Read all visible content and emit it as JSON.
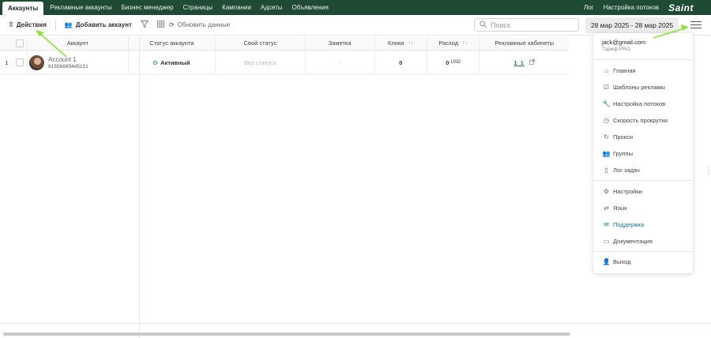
{
  "topnav": {
    "tabs": [
      {
        "label": "Аккаунты",
        "active": true
      },
      {
        "label": "Рекламные аккаунты"
      },
      {
        "label": "Бизнес менеджер"
      },
      {
        "label": "Страницы"
      },
      {
        "label": "Кампании"
      },
      {
        "label": "Адсеты"
      },
      {
        "label": "Объявления"
      }
    ],
    "right_links": [
      "Лог",
      "Настройка потоков"
    ],
    "brand": "Saint"
  },
  "toolbar": {
    "actions_label": "Действия",
    "add_account_label": "Добавить аккаунт",
    "refresh_label": "Обновить данные",
    "search_placeholder": "Поиск",
    "date_range": "28 мар 2025 - 28 мар 2025"
  },
  "table": {
    "headers": {
      "account": "Аккаунт",
      "account_status": "Статус аккаунта",
      "own_status": "Свой статус",
      "note": "Заметка",
      "clicks": "Клики",
      "spend": "Расход",
      "ad_cabinets": "Рекламные кабинеты"
    },
    "rows": [
      {
        "index": "1",
        "name": "Account 1",
        "id": "61556685445151",
        "status": "Активный",
        "own_status": "Без статуса",
        "note": "-",
        "clicks": "0",
        "spend": "0",
        "currency": "USD",
        "cabinets": "1 1"
      }
    ]
  },
  "menu": {
    "email": "jack@gmail.com",
    "plan": "Тариф PRO",
    "items": [
      {
        "label": "Главная",
        "icon": "home-icon"
      },
      {
        "label": "Шаблоны рекламы",
        "icon": "template-icon"
      },
      {
        "label": "Настройка потоков",
        "icon": "wrench-icon"
      },
      {
        "label": "Скорость прокрутки",
        "icon": "speed-icon"
      },
      {
        "label": "Прокси",
        "icon": "refresh-icon"
      },
      {
        "label": "Группы",
        "icon": "users-icon"
      },
      {
        "label": "Лог задач",
        "icon": "document-icon"
      },
      {
        "label": "Настройки",
        "icon": "gear-icon"
      },
      {
        "label": "Язык",
        "icon": "translate-icon"
      },
      {
        "label": "Поддержка",
        "icon": "mail-icon"
      },
      {
        "label": "Документация",
        "icon": "folder-icon"
      },
      {
        "label": "Выход",
        "icon": "user-icon"
      }
    ]
  },
  "colors": {
    "nav_bg": "#1f4a33",
    "accent_green": "#1a7a5a",
    "support_blue": "#1a6f9a",
    "annotation_arrow": "#8fe33a"
  }
}
